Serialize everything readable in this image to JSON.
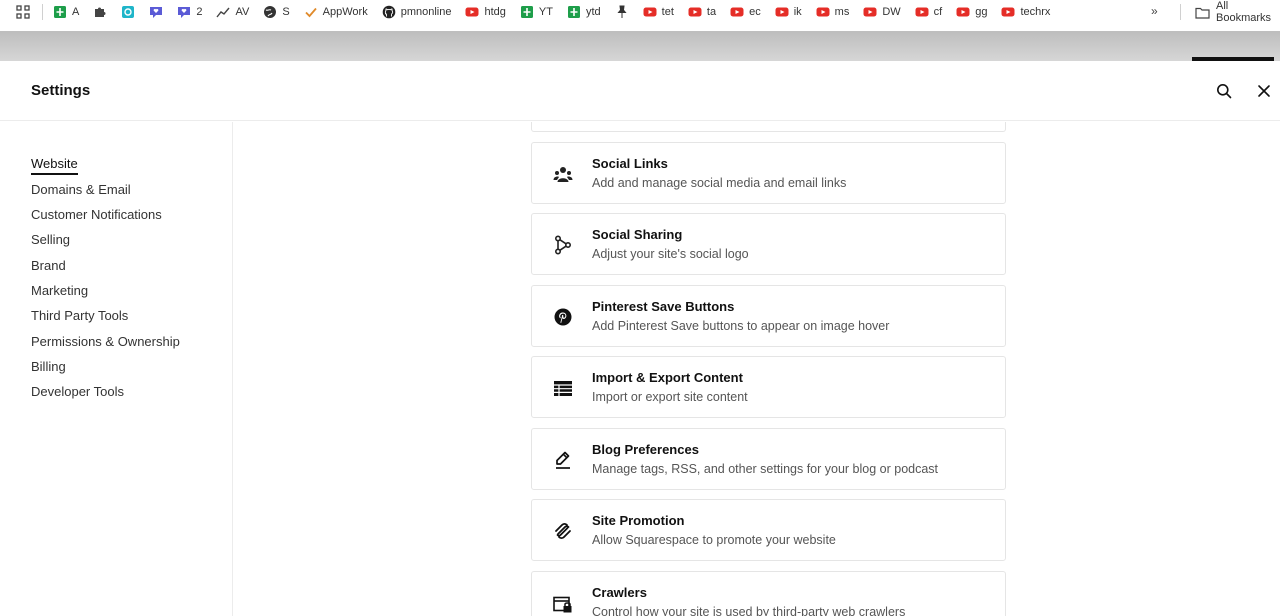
{
  "bookmarks": {
    "items": [
      {
        "label": "A",
        "icon": "sheets-icon",
        "color": "#1e9e4a"
      },
      {
        "label": "",
        "icon": "puzzle-icon",
        "color": "#444444"
      },
      {
        "label": "",
        "icon": "teal-app-icon",
        "color": "#1fb5c9"
      },
      {
        "label": "",
        "icon": "chat-heart-icon",
        "color": "#5b5bd6"
      },
      {
        "label": "2",
        "icon": "chat-heart-icon",
        "color": "#5b5bd6"
      },
      {
        "label": "AV",
        "icon": "trend-icon",
        "color": "#444444"
      },
      {
        "label": "S",
        "icon": "globe-icon",
        "color": "#333333"
      },
      {
        "label": "AppWork",
        "icon": "check-icon",
        "color": "#e08a2a"
      },
      {
        "label": "pmnonline",
        "icon": "github-icon",
        "color": "#222222"
      },
      {
        "label": "htdg",
        "icon": "youtube-icon",
        "color": "#e52d27"
      },
      {
        "label": "YT",
        "icon": "sheets-icon",
        "color": "#1e9e4a"
      },
      {
        "label": "ytd",
        "icon": "sheets-icon",
        "color": "#1e9e4a"
      },
      {
        "label": "",
        "icon": "pin-icon",
        "color": "#333333"
      },
      {
        "label": "tet",
        "icon": "youtube-icon",
        "color": "#e52d27"
      },
      {
        "label": "ta",
        "icon": "youtube-icon",
        "color": "#e52d27"
      },
      {
        "label": "ec",
        "icon": "youtube-icon",
        "color": "#e52d27"
      },
      {
        "label": "ik",
        "icon": "youtube-icon",
        "color": "#e52d27"
      },
      {
        "label": "ms",
        "icon": "youtube-icon",
        "color": "#e52d27"
      },
      {
        "label": "DW",
        "icon": "youtube-icon",
        "color": "#e52d27"
      },
      {
        "label": "cf",
        "icon": "youtube-icon",
        "color": "#e52d27"
      },
      {
        "label": "gg",
        "icon": "youtube-icon",
        "color": "#e52d27"
      },
      {
        "label": "techrx",
        "icon": "youtube-icon",
        "color": "#e52d27"
      }
    ],
    "more_label": "»",
    "all_label": "All Bookmarks"
  },
  "panel": {
    "title": "Settings"
  },
  "sidebar": {
    "items": [
      {
        "label": "Website",
        "active": true
      },
      {
        "label": "Domains & Email"
      },
      {
        "label": "Customer Notifications"
      },
      {
        "label": "Selling"
      },
      {
        "label": "Brand"
      },
      {
        "label": "Marketing"
      },
      {
        "label": "Third Party Tools"
      },
      {
        "label": "Permissions & Ownership"
      },
      {
        "label": "Billing"
      },
      {
        "label": "Developer Tools"
      }
    ]
  },
  "cards": [
    {
      "title": "Social Links",
      "desc": "Add and manage social media and email links",
      "icon": "people-icon"
    },
    {
      "title": "Social Sharing",
      "desc": "Adjust your site's social logo",
      "icon": "share-nodes-icon"
    },
    {
      "title": "Pinterest Save Buttons",
      "desc": "Add Pinterest Save buttons to appear on image hover",
      "icon": "pinterest-icon"
    },
    {
      "title": "Import & Export Content",
      "desc": "Import or export site content",
      "icon": "table-icon"
    },
    {
      "title": "Blog Preferences",
      "desc": "Manage tags, RSS, and other settings for your blog or podcast",
      "icon": "pen-edit-icon"
    },
    {
      "title": "Site Promotion",
      "desc": "Allow Squarespace to promote your website",
      "icon": "squarespace-icon"
    },
    {
      "title": "Crawlers",
      "desc": "Control how your site is used by third-party web crawlers",
      "icon": "crawler-lock-icon"
    }
  ]
}
